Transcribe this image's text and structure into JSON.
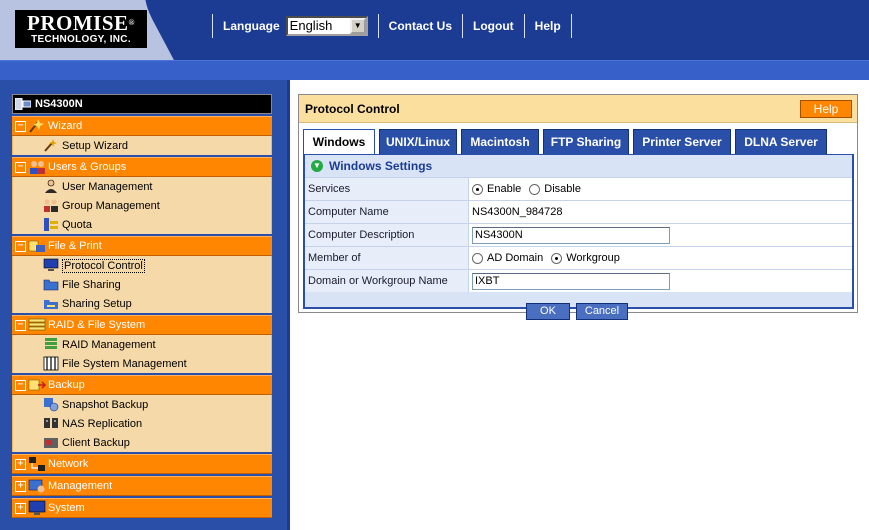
{
  "header": {
    "logo_line1": "PROMISE",
    "logo_reg": "®",
    "logo_line2": "TECHNOLOGY, INC.",
    "language_label": "Language",
    "language_value": "English",
    "contact_label": "Contact Us",
    "logout_label": "Logout",
    "help_label": "Help"
  },
  "sidebar": {
    "root": "NS4300N",
    "groups": [
      {
        "label": "Wizard",
        "toggle": "−",
        "items": [
          "Setup Wizard"
        ]
      },
      {
        "label": "Users & Groups",
        "toggle": "−",
        "items": [
          "User Management",
          "Group Management",
          "Quota"
        ]
      },
      {
        "label": "File & Print",
        "toggle": "−",
        "items": [
          "Protocol Control",
          "File Sharing",
          "Sharing Setup"
        ]
      },
      {
        "label": "RAID & File System",
        "toggle": "−",
        "items": [
          "RAID Management",
          "File System Management"
        ]
      },
      {
        "label": "Backup",
        "toggle": "−",
        "items": [
          "Snapshot Backup",
          "NAS Replication",
          "Client Backup"
        ]
      },
      {
        "label": "Network",
        "toggle": "+",
        "items": []
      },
      {
        "label": "Management",
        "toggle": "+",
        "items": []
      },
      {
        "label": "System",
        "toggle": "+",
        "items": []
      }
    ]
  },
  "panel": {
    "title": "Protocol Control",
    "help": "Help",
    "tabs": [
      "Windows",
      "UNIX/Linux",
      "Macintosh",
      "FTP Sharing",
      "Printer Server",
      "DLNA Server"
    ],
    "section": "Windows Settings",
    "rows": {
      "services_label": "Services",
      "enable": "Enable",
      "disable": "Disable",
      "computer_name_label": "Computer Name",
      "computer_name_value": "NS4300N_984728",
      "computer_desc_label": "Computer Description",
      "computer_desc_value": "NS4300N",
      "member_label": "Member of",
      "ad_domain": "AD Domain",
      "workgroup": "Workgroup",
      "domain_label": "Domain or Workgroup Name",
      "domain_value": "IXBT"
    },
    "ok": "OK",
    "cancel": "Cancel"
  },
  "colors": {
    "header_blue": "#1c3c94",
    "accent_orange": "#fe8600",
    "sidebar_item_bg": "#f5d9a8",
    "panel_title_bg": "#fbdf9e"
  }
}
